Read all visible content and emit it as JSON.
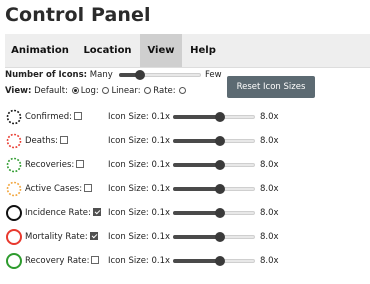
{
  "title": "Control Panel",
  "tabs": [
    {
      "label": "Animation",
      "active": false
    },
    {
      "label": "Location",
      "active": false
    },
    {
      "label": "View",
      "active": true
    },
    {
      "label": "Help",
      "active": false
    }
  ],
  "num_icons": {
    "label": "Number of Icons:",
    "min_label": "Many",
    "max_label": "Few",
    "level": 0.25
  },
  "view": {
    "label": "View:",
    "default_label": "Default:",
    "options": [
      {
        "label": "Log:",
        "selected": true
      },
      {
        "label": "Linear:",
        "selected": false
      },
      {
        "label": "Rate:",
        "selected": false
      }
    ]
  },
  "reset_button": "Reset Icon Sizes",
  "icon_size_label": "Icon Size: 0.1x",
  "icon_size_max": "8.0x",
  "layers": [
    {
      "label": "Confirmed:",
      "checked": false,
      "color": "#111111",
      "style": "dotted",
      "size_level": 0.57
    },
    {
      "label": "Deaths:",
      "checked": false,
      "color": "#e8392e",
      "style": "dotted",
      "size_level": 0.57
    },
    {
      "label": "Recoveries:",
      "checked": false,
      "color": "#2e9b2e",
      "style": "dotted",
      "size_level": 0.57
    },
    {
      "label": "Active Cases:",
      "checked": false,
      "color": "#f2a43a",
      "style": "dotted",
      "size_level": 0.57
    },
    {
      "label": "Incidence Rate:",
      "checked": true,
      "color": "#111111",
      "style": "solid",
      "size_level": 0.57
    },
    {
      "label": "Mortality Rate:",
      "checked": true,
      "color": "#e8392e",
      "style": "solid",
      "size_level": 0.57
    },
    {
      "label": "Recovery Rate:",
      "checked": false,
      "color": "#2e9b2e",
      "style": "solid",
      "size_level": 0.57
    }
  ]
}
